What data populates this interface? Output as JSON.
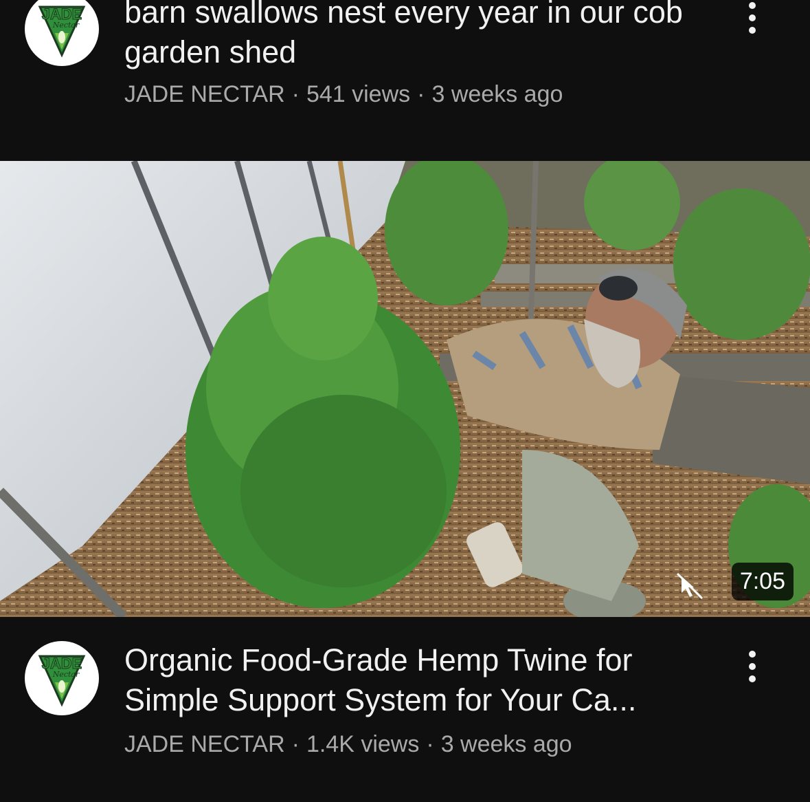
{
  "video1": {
    "title": "barn swallows nest every year in our cob garden shed",
    "channel": "JADE NECTAR",
    "views": "541 views",
    "age": "3 weeks ago",
    "avatar_icon": "jade-nectar-logo-icon",
    "menu_icon": "more-vertical-icon"
  },
  "video2": {
    "title": "Organic Food-Grade Hemp Twine for Simple Support System for Your Ca...",
    "channel": "JADE NECTAR",
    "views": "1.4K views",
    "age": "3 weeks ago",
    "duration": "7:05",
    "avatar_icon": "jade-nectar-logo-icon",
    "menu_icon": "more-vertical-icon",
    "cast_icon": "no-cast-icon"
  },
  "logo_text": {
    "line1": "JADE",
    "line2": "Nectar"
  },
  "separator": "·",
  "colors": {
    "background": "#0f0f0f",
    "title": "#f1f1f1",
    "subtitle": "#aaaaaa",
    "logo_green": "#2f8f3a",
    "logo_dark": "#1d3b1f"
  }
}
